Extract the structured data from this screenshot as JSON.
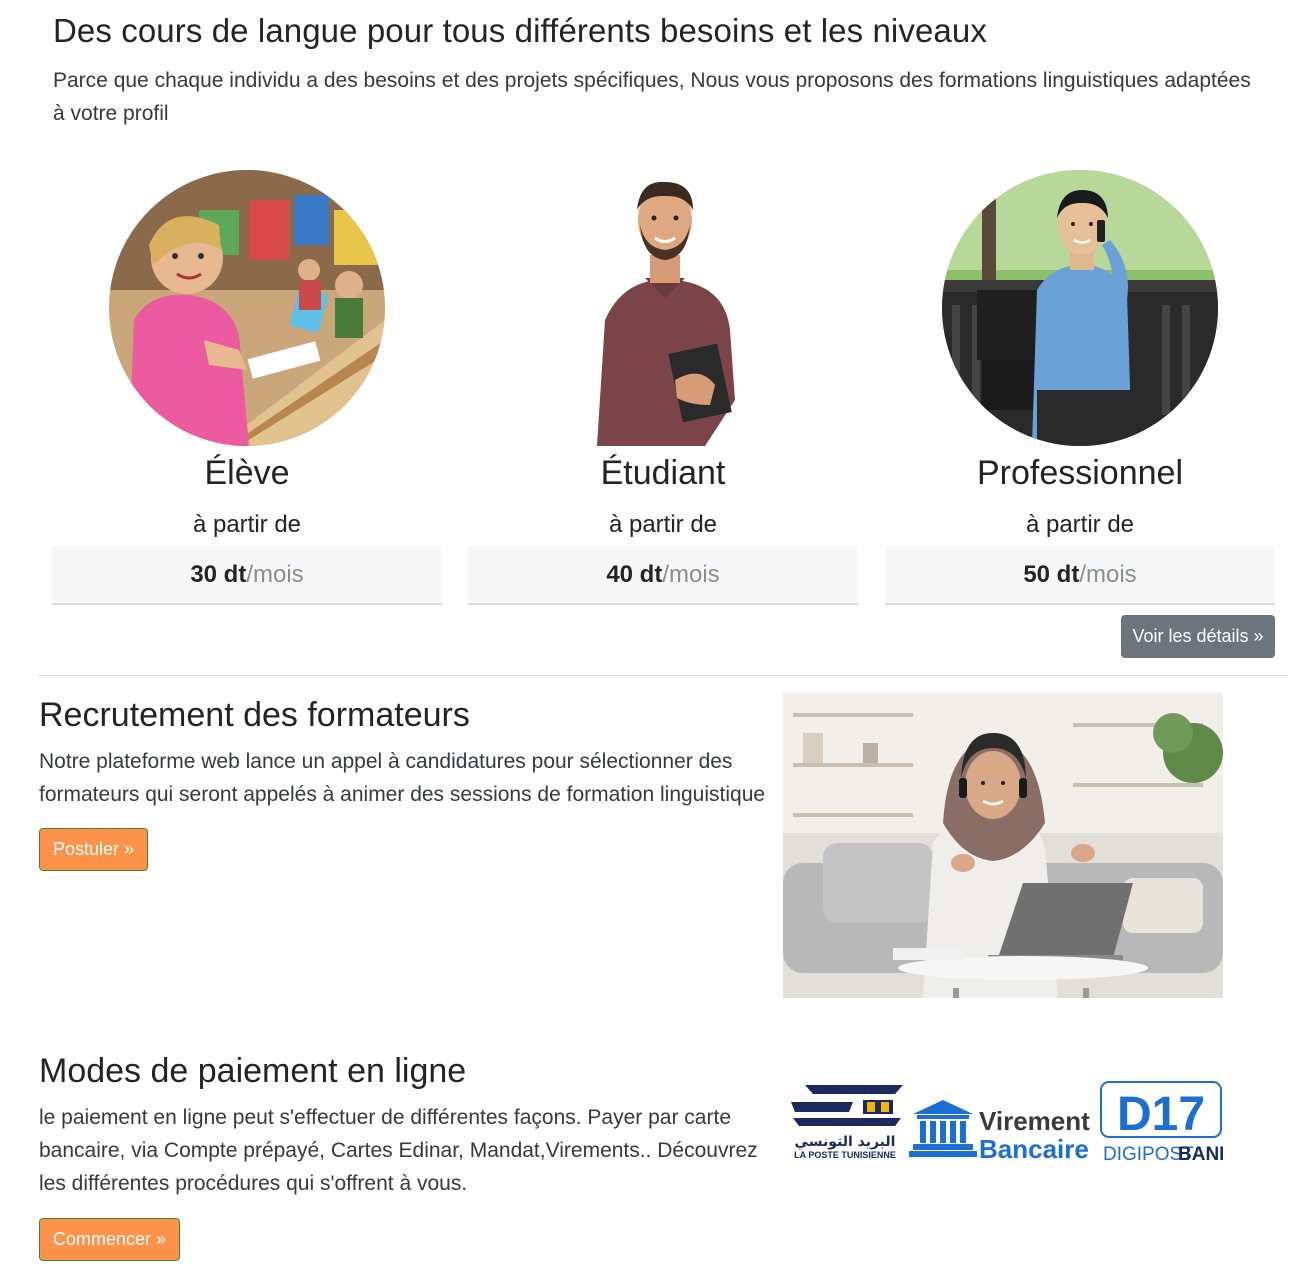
{
  "hero": {
    "title": "Des cours de langue pour tous différents besoins et les niveaux",
    "lead": "Parce que chaque individu a des besoins et des projets spécifiques, Nous vous proposons des formations linguistiques adaptées à votre profil"
  },
  "plans": [
    {
      "name": "Élève",
      "from": "à partir de",
      "amount": "30 dt",
      "per": "/mois",
      "image": "girl-in-classroom"
    },
    {
      "name": "Étudiant",
      "from": "à partir de",
      "amount": "40 dt",
      "per": "/mois",
      "image": "student-holding-notebook"
    },
    {
      "name": "Professionnel",
      "from": "à partir de",
      "amount": "50 dt",
      "per": "/mois",
      "image": "man-on-phone-outdoors"
    }
  ],
  "details_button": "Voir les détails »",
  "recruitment": {
    "title": "Recrutement des formateurs",
    "text": "Notre plateforme web lance un appel à candidatures pour sélectionner des formateurs qui seront appelés à animer des sessions de formation linguistique",
    "button": "Postuler »",
    "image": "woman-with-headset-and-laptop"
  },
  "payment": {
    "title": "Modes de paiement en ligne",
    "text": "le paiement en ligne peut s'effectuer de différentes façons. Payer par carte bancaire, via Compte prépayé, Cartes Edinar, Mandat,Virements.. Découvrez les différentes procédures qui s'offrent à vous.",
    "button": "Commencer »",
    "logos": {
      "poste_arabic": "البريد التونسي",
      "poste_latin": "LA POSTE TUNISIENNE",
      "virement_1": "Virement",
      "virement_2": "Bancaire",
      "d17": "D17",
      "digipost_1": "DIGIPOST",
      "digipost_2": "BANK"
    }
  },
  "colors": {
    "accent_orange": "#fd924b",
    "secondary_gray": "#6c757d",
    "brand_blue": "#1c6fd1",
    "poste_navy": "#1b2a5c",
    "poste_yellow": "#f4b400"
  }
}
